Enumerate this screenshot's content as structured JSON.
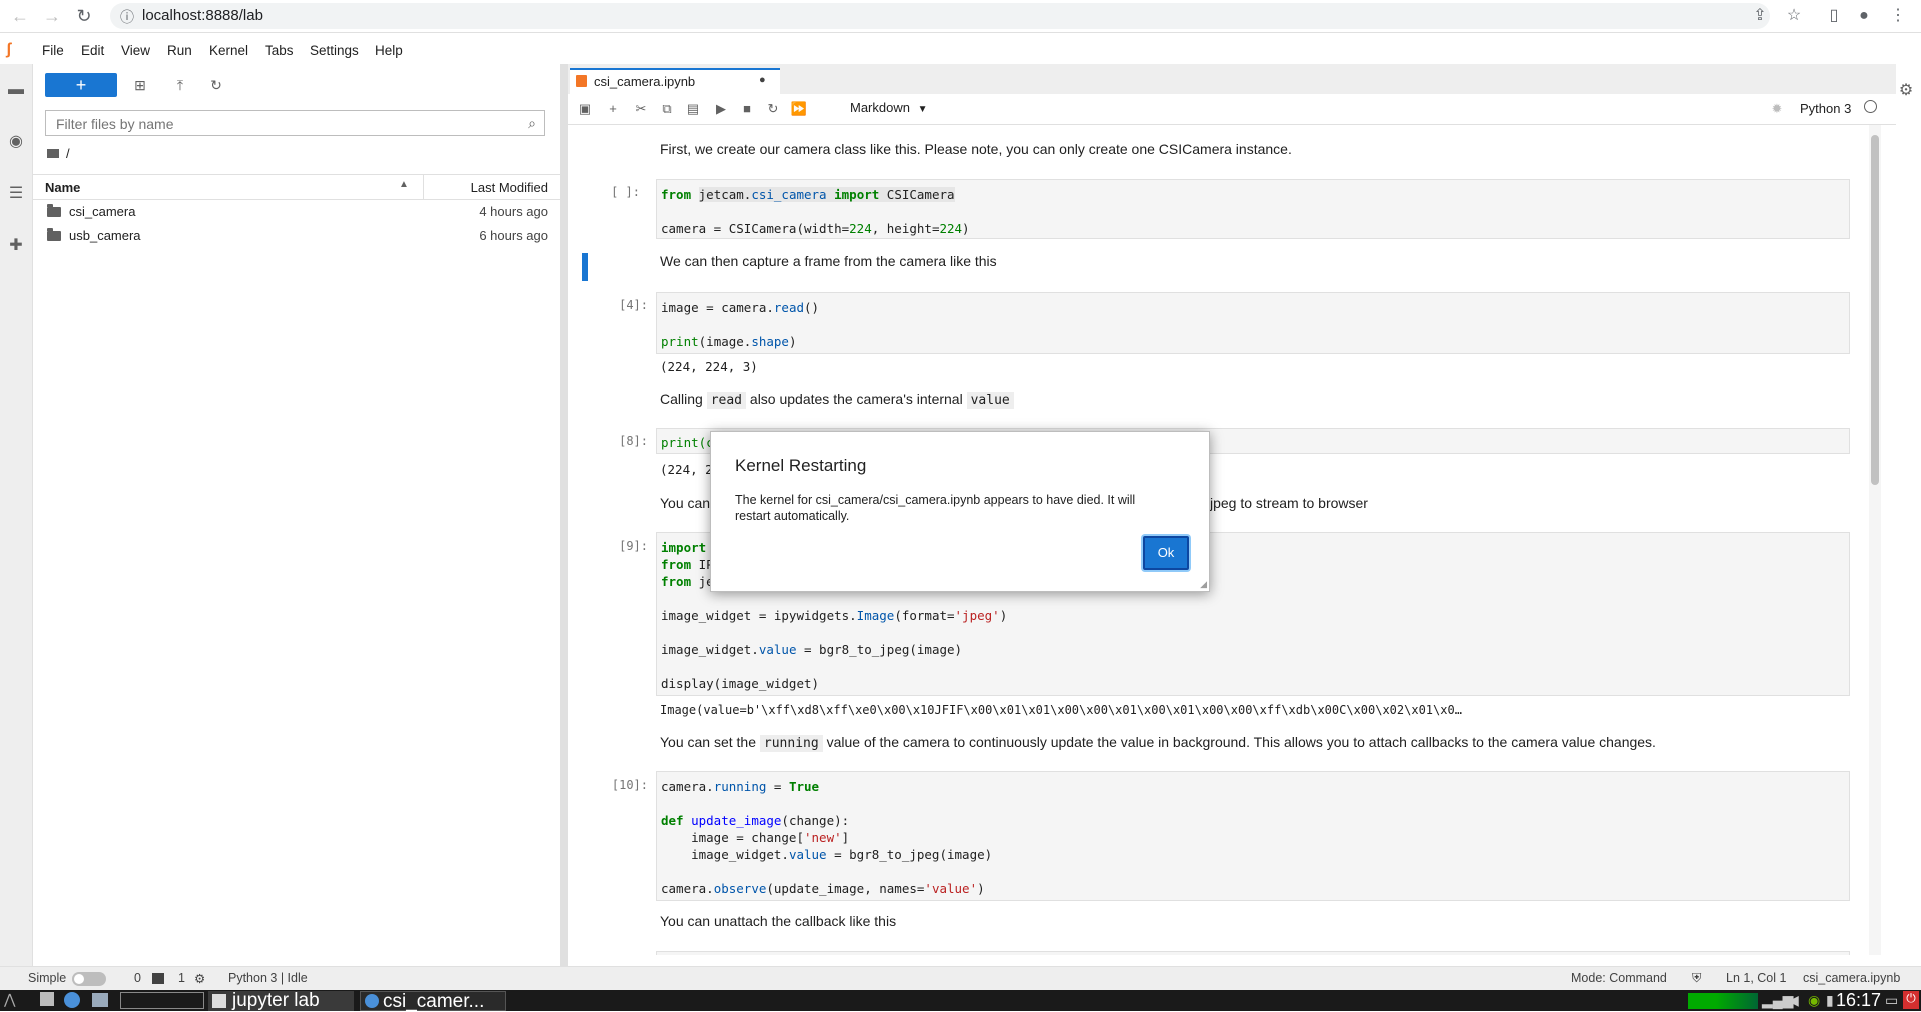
{
  "browser": {
    "url": "localhost:8888/lab"
  },
  "menu": [
    "File",
    "Edit",
    "View",
    "Run",
    "Kernel",
    "Tabs",
    "Settings",
    "Help"
  ],
  "filebrowser": {
    "new_label": "+",
    "filter_placeholder": "Filter files by name",
    "breadcrumb": "/",
    "col_name": "Name",
    "col_modified": "Last Modified",
    "files": [
      {
        "name": "csi_camera",
        "modified": "4 hours ago"
      },
      {
        "name": "usb_camera",
        "modified": "6 hours ago"
      }
    ]
  },
  "notebook": {
    "tab_title": "csi_camera.ipynb",
    "cell_type": "Markdown",
    "kernel_name": "Python 3",
    "md1": "First, we create our camera class like this. Please note, you can only create one CSICamera instance.",
    "prompt1": "[ ]:",
    "md2": "We can then capture a frame from the camera like this",
    "prompt2": "[4]:",
    "out2": "(224, 224, 3)",
    "md3_a": "Calling",
    "md3_code1": "read",
    "md3_b": "also updates the camera's internal",
    "md3_code2": "value",
    "prompt3": "[8]:",
    "code3_partial": "print(c",
    "out3_partial": "(224, 2",
    "md4_a": "You can",
    "md4_b": "jpeg to stream to browser",
    "prompt4": "[9]:",
    "out4": "Image(value=b'\\xff\\xd8\\xff\\xe0\\x00\\x10JFIF\\x00\\x01\\x01\\x00\\x00\\x01\\x00\\x01\\x00\\x00\\xff\\xdb\\x00C\\x00\\x02\\x01\\x0…",
    "md5_a": "You can set the",
    "md5_code": "running",
    "md5_b": "value of the camera to continuously update the value in background. This allows you to attach callbacks to the camera value changes.",
    "prompt5": "[10]:",
    "md6": "You can unattach the callback like this"
  },
  "statusbar": {
    "mode_label": "Simple",
    "terminals": "0",
    "kernels": "1",
    "kernel_status": "Python 3 | Idle",
    "mode": "Mode: Command",
    "position": "Ln 1, Col 1",
    "file": "csi_camera.ipynb"
  },
  "taskbar": {
    "app1": "jupyter lab",
    "app2": "csi_camer...",
    "clock": "16:17"
  },
  "dialog": {
    "title": "Kernel Restarting",
    "body": "The kernel for csi_camera/csi_camera.ipynb appears to have died. It will restart automatically.",
    "ok_label": "Ok"
  },
  "colors": {
    "accent": "#1976d2",
    "toolbar_bg": "#eeeeee"
  }
}
